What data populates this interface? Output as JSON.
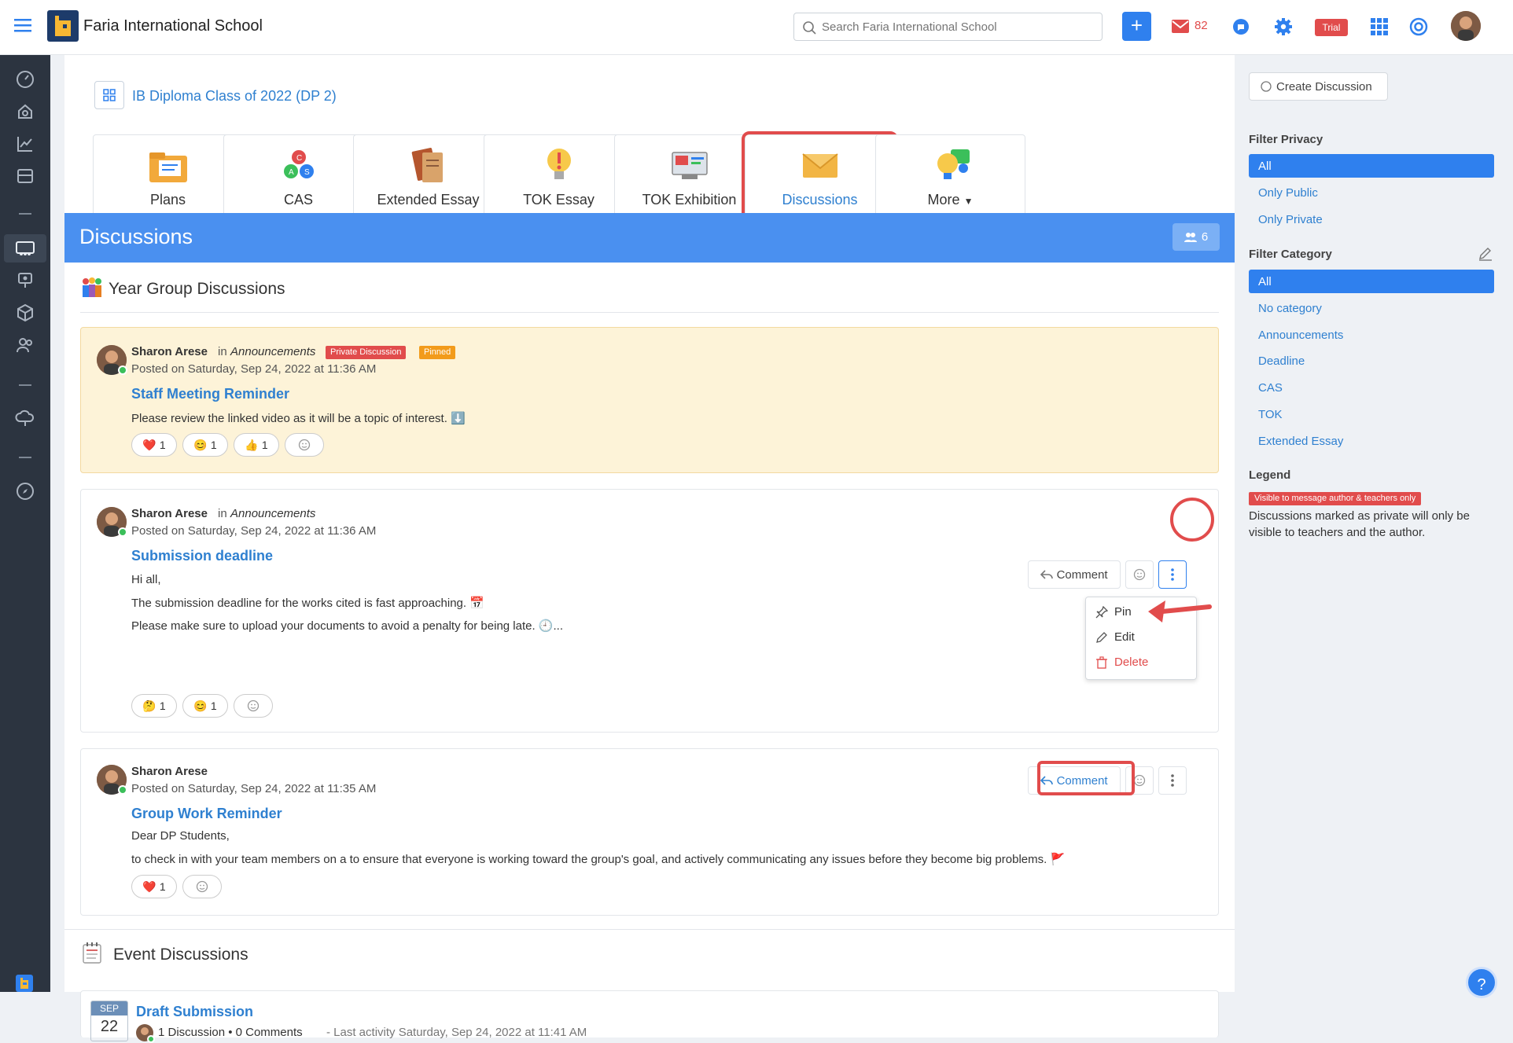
{
  "topbar": {
    "app_title": "Faria International School",
    "search_placeholder": "Search Faria International School",
    "mail_count": "82",
    "trial_label": "Trial"
  },
  "class": {
    "name": "IB Diploma Class of 2022 (DP 2)"
  },
  "tiles": [
    {
      "label": "Plans"
    },
    {
      "label": "CAS"
    },
    {
      "label": "Extended Essay"
    },
    {
      "label": "TOK Essay"
    },
    {
      "label": "TOK Exhibition"
    },
    {
      "label": "Discussions"
    },
    {
      "label": "More"
    }
  ],
  "banner": {
    "title": "Discussions",
    "member_count": "6"
  },
  "year_group": {
    "heading": "Year Group Discussions",
    "posts": [
      {
        "author": "Sharon Arese",
        "in_word": "in",
        "category": "Announcements",
        "badge_private": "Private Discussion",
        "badge_pinned": "Pinned",
        "posted": "Posted on Saturday, Sep 24, 2022 at 11:36 AM",
        "title": "Staff Meeting Reminder",
        "lines": [
          "Please review the linked video as it will be a topic of interest. ⬇️"
        ],
        "reactions": [
          {
            "emoji": "❤️",
            "count": "1"
          },
          {
            "emoji": "😊",
            "count": "1"
          },
          {
            "emoji": "👍",
            "count": "1"
          }
        ]
      },
      {
        "author": "Sharon Arese",
        "in_word": "in",
        "category": "Announcements",
        "posted": "Posted on Saturday, Sep 24, 2022 at 11:36 AM",
        "title": "Submission deadline",
        "lines": [
          "Hi all,",
          "The submission deadline for the works cited is fast approaching. 📅",
          "Please make sure to upload your documents to avoid a penalty for being late. 🕘..."
        ],
        "reactions": [
          {
            "emoji": "🤔",
            "count": "1"
          },
          {
            "emoji": "😊",
            "count": "1"
          }
        ],
        "comment_label": "Comment",
        "menu": {
          "pin": "Pin",
          "edit": "Edit",
          "delete": "Delete"
        }
      },
      {
        "author": "Sharon Arese",
        "posted": "Posted on Saturday, Sep 24, 2022 at 11:35 AM",
        "title": "Group Work Reminder",
        "lines": [
          "Dear DP Students,",
          "to check in with your team members on a  to ensure that everyone is working toward the group's goal, and actively communicating any issues before they become big problems. 🚩"
        ],
        "reactions": [
          {
            "emoji": "❤️",
            "count": "1"
          }
        ],
        "comment_label": "Comment"
      }
    ]
  },
  "event_group": {
    "heading": "Event Discussions",
    "events": [
      {
        "month": "SEP",
        "day": "22",
        "title": "Draft Submission",
        "summary": "1 Discussion • 0 Comments",
        "activity": "- Last activity Saturday, Sep 24, 2022 at 11:41 AM"
      }
    ]
  },
  "right_panel": {
    "create_label": "Create Discussion",
    "filter_privacy_heading": "Filter Privacy",
    "privacy_options": [
      "All",
      "Only Public",
      "Only Private"
    ],
    "filter_category_heading": "Filter Category",
    "category_options": [
      "All",
      "No category",
      "Announcements",
      "Deadline",
      "CAS",
      "TOK",
      "Extended Essay"
    ],
    "legend_heading": "Legend",
    "legend_badge": "Visible to message author & teachers only",
    "legend_text": "Discussions marked as private will only be visible to teachers and the author."
  },
  "colors": {
    "accent": "#2f80ee",
    "sidebar": "#2c3440",
    "highlight_red": "#e14c4c",
    "pinned_bg": "#fdf3d8"
  }
}
